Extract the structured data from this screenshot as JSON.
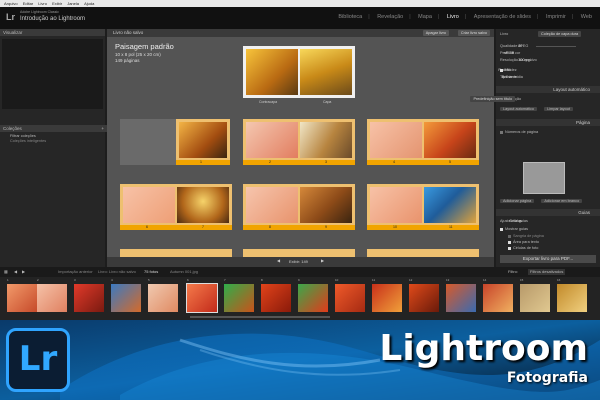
{
  "menubar": {
    "items": [
      "Arquivo",
      "Editar",
      "Livro",
      "Exibir",
      "Janela",
      "Ajuda"
    ]
  },
  "identity": {
    "logo": "Lr",
    "subtitle": "Adobe Lightroom Classic",
    "catalog_title": "Introdução ao Lightroom"
  },
  "modules": {
    "items": [
      "Biblioteca",
      "Revelação",
      "Mapa",
      "Livro",
      "Apresentação de slides",
      "Imprimir",
      "Web"
    ],
    "active_index": 3
  },
  "left_panel": {
    "navigator_title": "Visualizar",
    "collections_title": "Coleções",
    "collection_items": [
      "Filtrar coleções",
      "Coleções inteligentes"
    ]
  },
  "center": {
    "bar_title": "Livro não salvo",
    "btn_clear": "Apagar livro",
    "btn_create": "Criar livro salvo",
    "book_title": "Paisagem padrão",
    "book_size": "10 x 8 pol (25 x 20 cm)",
    "book_pages": "149 páginas",
    "cover_labels": [
      "Contracapa",
      "Capa"
    ],
    "row1_pages": [
      "1",
      "2",
      "3",
      "4",
      "5"
    ],
    "row2_pages": [
      "6",
      "7",
      "8",
      "9",
      "10",
      "11"
    ],
    "footer_view": "Exibir: 149"
  },
  "right_panel": {
    "book_label": "Livro",
    "book_value": "Coleção de capa dura",
    "quality_label": "Qualidade JPEG",
    "quality_value": "80",
    "profile_label": "Perfil de cor",
    "profile_value": "sRGB",
    "resolution_label": "Resolução do arquivo",
    "resolution_value": "300 ppi",
    "sharpen_label": "Nitidez",
    "sharpen_value": "Padrão",
    "media_label": "Tipo de mídia",
    "media_value": "Brilhante",
    "autolayout_title": "Layout automático",
    "preset_label": "Predefinição",
    "preset_value": "Predefinição sem título",
    "autolayout_btn1": "Layout automático",
    "autolayout_btn2": "Limpar layout",
    "page_title": "Página",
    "page_number_label": "Números de página",
    "page_btn1": "Adicionar página",
    "page_btn2": "Adicionar em branco",
    "guides_title": "Guias",
    "guides_show_label": "Mostrar guias",
    "guides_label": "Ajustes de guias",
    "guides_value": "Células",
    "guides_items": [
      "Sangria de página",
      "Área para texto",
      "Células de foto"
    ],
    "export_label": "Exportar livro para PDF..."
  },
  "filmbar": {
    "source": "Importação anterior",
    "path": "Livro: Livro não salvo",
    "count": "75 fotos",
    "selected": "Autumn 001.jpg",
    "filter_label": "Filtro:",
    "filter_value": "Filtros desativados"
  },
  "filmstrip": {
    "numbers": [
      "1",
      "2",
      "3",
      "4",
      "5",
      "6",
      "7",
      "8",
      "9",
      "10",
      "11",
      "12",
      "13",
      "14",
      "15",
      "16"
    ]
  },
  "banner": {
    "badge_text": "Lr",
    "title": "Lightroom",
    "subtitle": "Fotografia",
    "accent": "#31a8ff"
  },
  "colors": {
    "page_bar": "#f1a400",
    "app_bg": "#1d1d1d",
    "center_bg": "#545454"
  }
}
